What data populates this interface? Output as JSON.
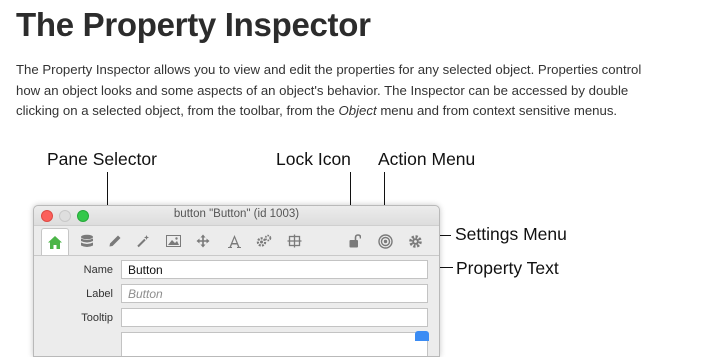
{
  "heading": "The Property Inspector",
  "intro": {
    "line1": "The Property Inspector allows you to view and edit the properties for any selected object. Properties control",
    "line2": "how an object looks and some aspects of an object's behavior. The Inspector can be accessed by double",
    "line3_before": "clicking on a selected object, from the toolbar, from the ",
    "line3_em": "Object",
    "line3_after": " menu and from context sensitive menus."
  },
  "callouts": {
    "pane_selector": "Pane Selector",
    "lock_icon": "Lock Icon",
    "action_menu": "Action Menu",
    "settings_menu": "Settings Menu",
    "property_text": "Property Text"
  },
  "inspector": {
    "window_title": "button \"Button\" (id 1003)",
    "toolbar_icons": [
      "home-icon",
      "database-icon",
      "pencil-icon",
      "magic-wand-icon",
      "image-icon",
      "move-icon",
      "text-icon",
      "gears-icon",
      "geometry-icon",
      "lock-icon",
      "target-icon",
      "gear-icon"
    ],
    "fields": [
      {
        "label": "Name",
        "value": "Button",
        "placeholder": ""
      },
      {
        "label": "Label",
        "value": "",
        "placeholder": "Button"
      },
      {
        "label": "Tooltip",
        "value": "",
        "placeholder": ""
      }
    ]
  },
  "colors": {
    "active_tab_icon": "#4cb548",
    "icon_gray": "#7a7a7a",
    "accent_blue": "#3b8cf4"
  }
}
